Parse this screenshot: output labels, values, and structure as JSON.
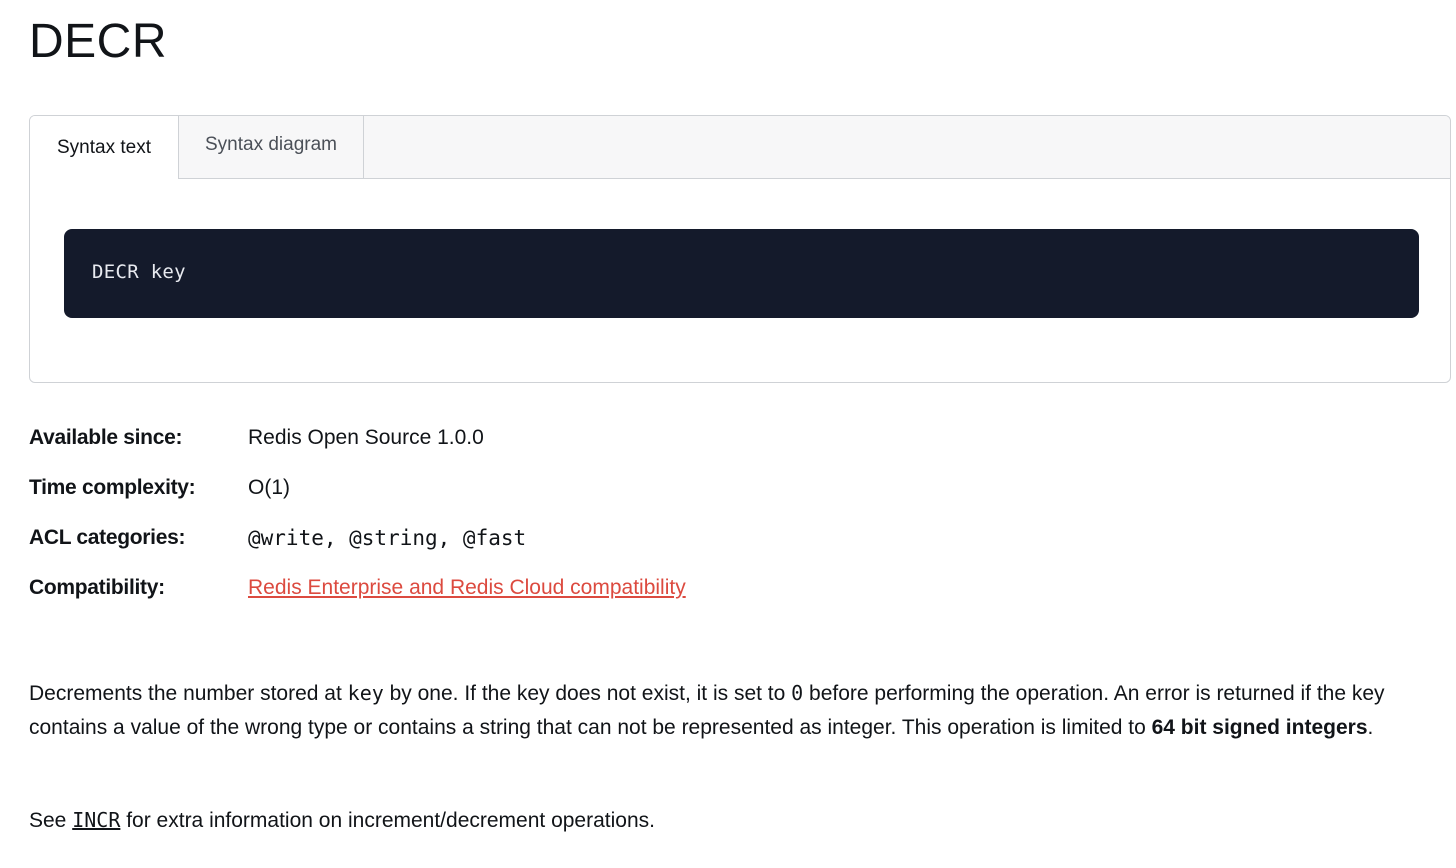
{
  "page": {
    "title": "DECR"
  },
  "tabs": [
    {
      "label": "Syntax text",
      "active": true
    },
    {
      "label": "Syntax diagram",
      "active": false
    }
  ],
  "syntax": {
    "code": "DECR key"
  },
  "meta": {
    "available_since": {
      "label": "Available since:",
      "value": "Redis Open Source 1.0.0"
    },
    "time_complexity": {
      "label": "Time complexity:",
      "value": "O(1)"
    },
    "acl_categories": {
      "label": "ACL categories:",
      "value": "@write, @string, @fast"
    },
    "compatibility": {
      "label": "Compatibility:",
      "value": "Redis Enterprise and Redis Cloud compatibility"
    }
  },
  "description": {
    "part1": "Decrements the number stored at ",
    "code1": "key",
    "part2": " by one. If the key does not exist, it is set to ",
    "code2": "0",
    "part3": " before performing the operation. An error is returned if the key contains a value of the wrong type or contains a string that can not be represented as integer. This operation is limited to ",
    "bold": "64 bit signed integers",
    "part4": "."
  },
  "see_also": {
    "prefix": "See ",
    "link": "INCR",
    "suffix": " for extra information on increment/decrement operations."
  },
  "colors": {
    "link_accent": "#dc4a3f",
    "code_bg": "#141a2b"
  }
}
